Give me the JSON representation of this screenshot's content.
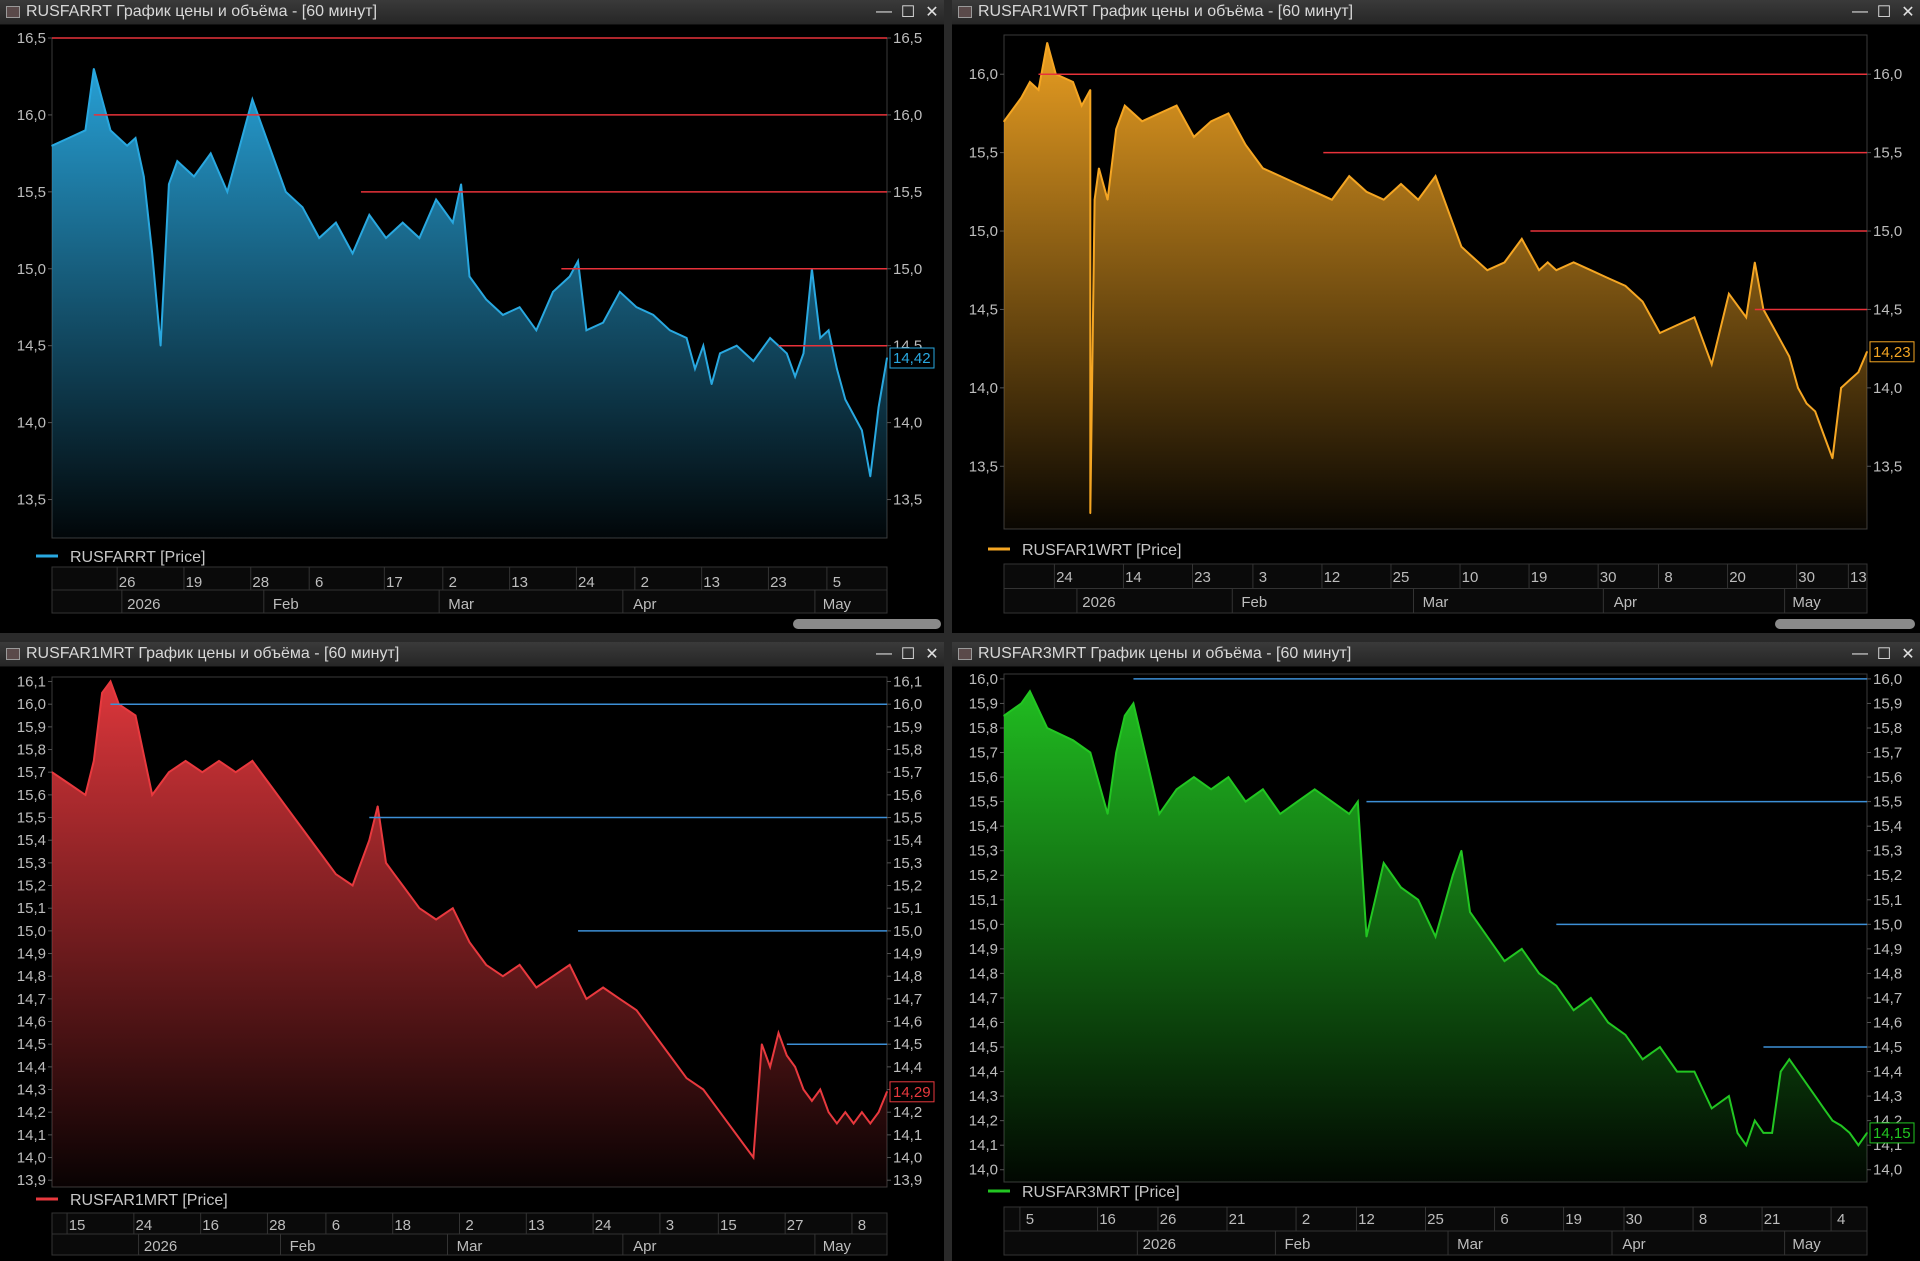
{
  "window_controls": {
    "minimize": "—",
    "maximize": "☐",
    "close": "✕"
  },
  "charts": [
    {
      "title": "RUSFARRT График цены и объёма - [60 минут]",
      "legend": "RUSFARRT [Price]",
      "color": "#29a8e0",
      "line_color": "#e8323a",
      "last_value_label": "14,42",
      "chart_data": {
        "type": "area",
        "ylim": [
          13.25,
          16.5
        ],
        "yticks": [
          "16,5",
          "16,0",
          "15,5",
          "15,0",
          "14,5",
          "14,0",
          "13,5"
        ],
        "ytick_values": [
          16.5,
          16.0,
          15.5,
          15.0,
          14.5,
          14.0,
          13.5
        ],
        "x_day_ticks": [
          "26",
          "19",
          "28",
          "6",
          "17",
          "2",
          "13",
          "24",
          "2",
          "13",
          "23",
          "5"
        ],
        "x_month_ticks": [
          "2026",
          "Feb",
          "Mar",
          "Apr",
          "May"
        ],
        "ref_lines": [
          {
            "value": 16.5,
            "from": 0.0
          },
          {
            "value": 16.0,
            "from": 0.05
          },
          {
            "value": 15.5,
            "from": 0.37
          },
          {
            "value": 15.0,
            "from": 0.61
          },
          {
            "value": 14.5,
            "from": 0.87
          }
        ],
        "x": [
          0,
          0.02,
          0.04,
          0.05,
          0.07,
          0.09,
          0.1,
          0.11,
          0.12,
          0.13,
          0.14,
          0.15,
          0.17,
          0.19,
          0.21,
          0.22,
          0.24,
          0.26,
          0.28,
          0.3,
          0.32,
          0.34,
          0.36,
          0.38,
          0.4,
          0.42,
          0.44,
          0.46,
          0.48,
          0.49,
          0.5,
          0.52,
          0.54,
          0.56,
          0.58,
          0.6,
          0.62,
          0.63,
          0.64,
          0.66,
          0.68,
          0.7,
          0.72,
          0.74,
          0.76,
          0.77,
          0.78,
          0.79,
          0.8,
          0.82,
          0.84,
          0.86,
          0.87,
          0.88,
          0.89,
          0.9,
          0.91,
          0.92,
          0.93,
          0.94,
          0.95,
          0.96,
          0.97,
          0.98,
          0.99,
          1.0
        ],
        "values": [
          15.8,
          15.85,
          15.9,
          16.3,
          15.9,
          15.8,
          15.85,
          15.6,
          15.1,
          14.5,
          15.55,
          15.7,
          15.6,
          15.75,
          15.5,
          15.7,
          16.1,
          15.8,
          15.5,
          15.4,
          15.2,
          15.3,
          15.1,
          15.35,
          15.2,
          15.3,
          15.2,
          15.45,
          15.3,
          15.55,
          14.95,
          14.8,
          14.7,
          14.75,
          14.6,
          14.85,
          14.95,
          15.05,
          14.6,
          14.65,
          14.85,
          14.75,
          14.7,
          14.6,
          14.55,
          14.35,
          14.5,
          14.25,
          14.45,
          14.5,
          14.4,
          14.55,
          14.5,
          14.45,
          14.3,
          14.45,
          15.0,
          14.55,
          14.6,
          14.35,
          14.15,
          14.05,
          13.95,
          13.65,
          14.1,
          14.42
        ]
      }
    },
    {
      "title": "RUSFAR1WRT График цены и объёма - [60 минут]",
      "legend": "RUSFAR1WRT [Price]",
      "color": "#f5a623",
      "line_color": "#e8323a",
      "last_value_label": "14,23",
      "chart_data": {
        "type": "area",
        "ylim": [
          13.1,
          16.25
        ],
        "yticks": [
          "16,0",
          "15,5",
          "15,0",
          "14,5",
          "14,0",
          "13,5"
        ],
        "ytick_values": [
          16.0,
          15.5,
          15.0,
          14.5,
          14.0,
          13.5
        ],
        "x_day_ticks": [
          "24",
          "14",
          "23",
          "3",
          "12",
          "25",
          "10",
          "19",
          "30",
          "8",
          "20",
          "30",
          "13"
        ],
        "x_month_ticks": [
          "2026",
          "Feb",
          "Mar",
          "Apr",
          "May"
        ],
        "ref_lines": [
          {
            "value": 16.0,
            "from": 0.04
          },
          {
            "value": 15.5,
            "from": 0.37
          },
          {
            "value": 15.0,
            "from": 0.61
          },
          {
            "value": 14.5,
            "from": 0.87
          }
        ],
        "x": [
          0,
          0.02,
          0.03,
          0.04,
          0.05,
          0.06,
          0.08,
          0.09,
          0.1,
          0.1,
          0.105,
          0.11,
          0.12,
          0.13,
          0.14,
          0.16,
          0.18,
          0.2,
          0.22,
          0.24,
          0.26,
          0.28,
          0.3,
          0.32,
          0.34,
          0.36,
          0.38,
          0.4,
          0.42,
          0.44,
          0.46,
          0.48,
          0.5,
          0.52,
          0.53,
          0.54,
          0.56,
          0.58,
          0.6,
          0.62,
          0.63,
          0.64,
          0.66,
          0.68,
          0.7,
          0.72,
          0.74,
          0.76,
          0.78,
          0.8,
          0.82,
          0.84,
          0.86,
          0.87,
          0.88,
          0.89,
          0.9,
          0.91,
          0.92,
          0.93,
          0.94,
          0.95,
          0.96,
          0.97,
          0.98,
          0.99,
          1.0
        ],
        "values": [
          15.7,
          15.85,
          15.95,
          15.9,
          16.2,
          16.0,
          15.95,
          15.8,
          15.9,
          13.2,
          15.2,
          15.4,
          15.2,
          15.65,
          15.8,
          15.7,
          15.75,
          15.8,
          15.6,
          15.7,
          15.75,
          15.55,
          15.4,
          15.35,
          15.3,
          15.25,
          15.2,
          15.35,
          15.25,
          15.2,
          15.3,
          15.2,
          15.35,
          15.05,
          14.9,
          14.85,
          14.75,
          14.8,
          14.95,
          14.75,
          14.8,
          14.75,
          14.8,
          14.75,
          14.7,
          14.65,
          14.55,
          14.35,
          14.4,
          14.45,
          14.15,
          14.6,
          14.45,
          14.8,
          14.5,
          14.4,
          14.3,
          14.2,
          14.0,
          13.9,
          13.85,
          13.7,
          13.55,
          14.0,
          14.05,
          14.1,
          14.23
        ]
      }
    },
    {
      "title": "RUSFAR1MRT График цены и объёма - [60 минут]",
      "legend": "RUSFAR1MRT [Price]",
      "color": "#e8393e",
      "line_color": "#3d8fd6",
      "last_value_label": "14,29",
      "chart_data": {
        "type": "area",
        "ylim": [
          13.87,
          16.12
        ],
        "yticks": [
          "16,1",
          "16,0",
          "15,9",
          "15,8",
          "15,7",
          "15,6",
          "15,5",
          "15,4",
          "15,3",
          "15,2",
          "15,1",
          "15,0",
          "14,9",
          "14,8",
          "14,7",
          "14,6",
          "14,5",
          "14,4",
          "14,3",
          "14,2",
          "14,1",
          "14,0",
          "13,9"
        ],
        "ytick_values": [
          16.1,
          16.0,
          15.9,
          15.8,
          15.7,
          15.6,
          15.5,
          15.4,
          15.3,
          15.2,
          15.1,
          15.0,
          14.9,
          14.8,
          14.7,
          14.6,
          14.5,
          14.4,
          14.3,
          14.2,
          14.1,
          14.0,
          13.9
        ],
        "x_day_ticks": [
          "15",
          "24",
          "16",
          "28",
          "6",
          "18",
          "2",
          "13",
          "24",
          "3",
          "15",
          "27",
          "8"
        ],
        "x_month_ticks": [
          "2026",
          "Feb",
          "Mar",
          "Apr",
          "May"
        ],
        "ref_lines": [
          {
            "value": 16.0,
            "from": 0.07
          },
          {
            "value": 15.5,
            "from": 0.38
          },
          {
            "value": 15.0,
            "from": 0.63
          },
          {
            "value": 14.5,
            "from": 0.88
          }
        ],
        "x": [
          0,
          0.02,
          0.04,
          0.05,
          0.06,
          0.07,
          0.08,
          0.1,
          0.12,
          0.13,
          0.14,
          0.16,
          0.18,
          0.2,
          0.22,
          0.24,
          0.26,
          0.28,
          0.3,
          0.32,
          0.34,
          0.36,
          0.38,
          0.39,
          0.4,
          0.41,
          0.42,
          0.44,
          0.46,
          0.48,
          0.5,
          0.52,
          0.54,
          0.56,
          0.58,
          0.6,
          0.62,
          0.64,
          0.66,
          0.68,
          0.7,
          0.72,
          0.74,
          0.76,
          0.78,
          0.8,
          0.82,
          0.84,
          0.85,
          0.86,
          0.87,
          0.88,
          0.89,
          0.9,
          0.91,
          0.92,
          0.93,
          0.94,
          0.95,
          0.96,
          0.97,
          0.98,
          0.99,
          1.0
        ],
        "values": [
          15.7,
          15.65,
          15.6,
          15.75,
          16.05,
          16.1,
          16.0,
          15.95,
          15.6,
          15.65,
          15.7,
          15.75,
          15.7,
          15.75,
          15.7,
          15.75,
          15.65,
          15.55,
          15.45,
          15.35,
          15.25,
          15.2,
          15.4,
          15.55,
          15.3,
          15.25,
          15.2,
          15.1,
          15.05,
          15.1,
          14.95,
          14.85,
          14.8,
          14.85,
          14.75,
          14.8,
          14.85,
          14.7,
          14.75,
          14.7,
          14.65,
          14.55,
          14.45,
          14.35,
          14.3,
          14.2,
          14.1,
          14.0,
          14.5,
          14.4,
          14.55,
          14.45,
          14.4,
          14.3,
          14.25,
          14.3,
          14.2,
          14.15,
          14.2,
          14.15,
          14.2,
          14.15,
          14.2,
          14.29
        ]
      }
    },
    {
      "title": "RUSFAR3MRT График цены и объёма - [60 минут]",
      "legend": "RUSFAR3MRT [Price]",
      "color": "#22c622",
      "line_color": "#3d8fd6",
      "last_value_label": "14,15",
      "chart_data": {
        "type": "area",
        "ylim": [
          13.95,
          16.02
        ],
        "yticks": [
          "16,0",
          "15,9",
          "15,8",
          "15,7",
          "15,6",
          "15,5",
          "15,4",
          "15,3",
          "15,2",
          "15,1",
          "15,0",
          "14,9",
          "14,8",
          "14,7",
          "14,6",
          "14,5",
          "14,4",
          "14,3",
          "14,2",
          "14,1",
          "14,0"
        ],
        "ytick_values": [
          16.0,
          15.9,
          15.8,
          15.7,
          15.6,
          15.5,
          15.4,
          15.3,
          15.2,
          15.1,
          15.0,
          14.9,
          14.8,
          14.7,
          14.6,
          14.5,
          14.4,
          14.3,
          14.2,
          14.1,
          14.0
        ],
        "x_day_ticks": [
          "5",
          "16",
          "26",
          "21",
          "2",
          "12",
          "25",
          "6",
          "19",
          "30",
          "8",
          "21",
          "4"
        ],
        "x_month_ticks": [
          "2026",
          "Feb",
          "Mar",
          "Apr",
          "May"
        ],
        "ref_lines": [
          {
            "value": 16.0,
            "from": 0.15
          },
          {
            "value": 15.5,
            "from": 0.42
          },
          {
            "value": 15.0,
            "from": 0.64
          },
          {
            "value": 14.5,
            "from": 0.88
          }
        ],
        "x": [
          0,
          0.02,
          0.03,
          0.05,
          0.08,
          0.1,
          0.12,
          0.13,
          0.14,
          0.15,
          0.16,
          0.18,
          0.2,
          0.22,
          0.24,
          0.26,
          0.28,
          0.3,
          0.32,
          0.34,
          0.36,
          0.38,
          0.4,
          0.41,
          0.42,
          0.43,
          0.44,
          0.46,
          0.48,
          0.5,
          0.52,
          0.53,
          0.54,
          0.56,
          0.58,
          0.6,
          0.62,
          0.64,
          0.66,
          0.68,
          0.7,
          0.72,
          0.74,
          0.76,
          0.78,
          0.8,
          0.82,
          0.84,
          0.85,
          0.86,
          0.87,
          0.88,
          0.89,
          0.9,
          0.91,
          0.92,
          0.93,
          0.94,
          0.95,
          0.96,
          0.97,
          0.98,
          0.99,
          1.0
        ],
        "values": [
          15.85,
          15.9,
          15.95,
          15.8,
          15.75,
          15.7,
          15.45,
          15.7,
          15.85,
          15.9,
          15.75,
          15.45,
          15.55,
          15.6,
          15.55,
          15.6,
          15.5,
          15.55,
          15.45,
          15.5,
          15.55,
          15.5,
          15.45,
          15.5,
          14.95,
          15.1,
          15.25,
          15.15,
          15.1,
          14.95,
          15.2,
          15.3,
          15.05,
          14.95,
          14.85,
          14.9,
          14.8,
          14.75,
          14.65,
          14.7,
          14.6,
          14.55,
          14.45,
          14.5,
          14.4,
          14.4,
          14.25,
          14.3,
          14.15,
          14.1,
          14.2,
          14.15,
          14.15,
          14.4,
          14.45,
          14.4,
          14.35,
          14.3,
          14.25,
          14.2,
          14.18,
          14.15,
          14.1,
          14.15
        ]
      }
    }
  ]
}
